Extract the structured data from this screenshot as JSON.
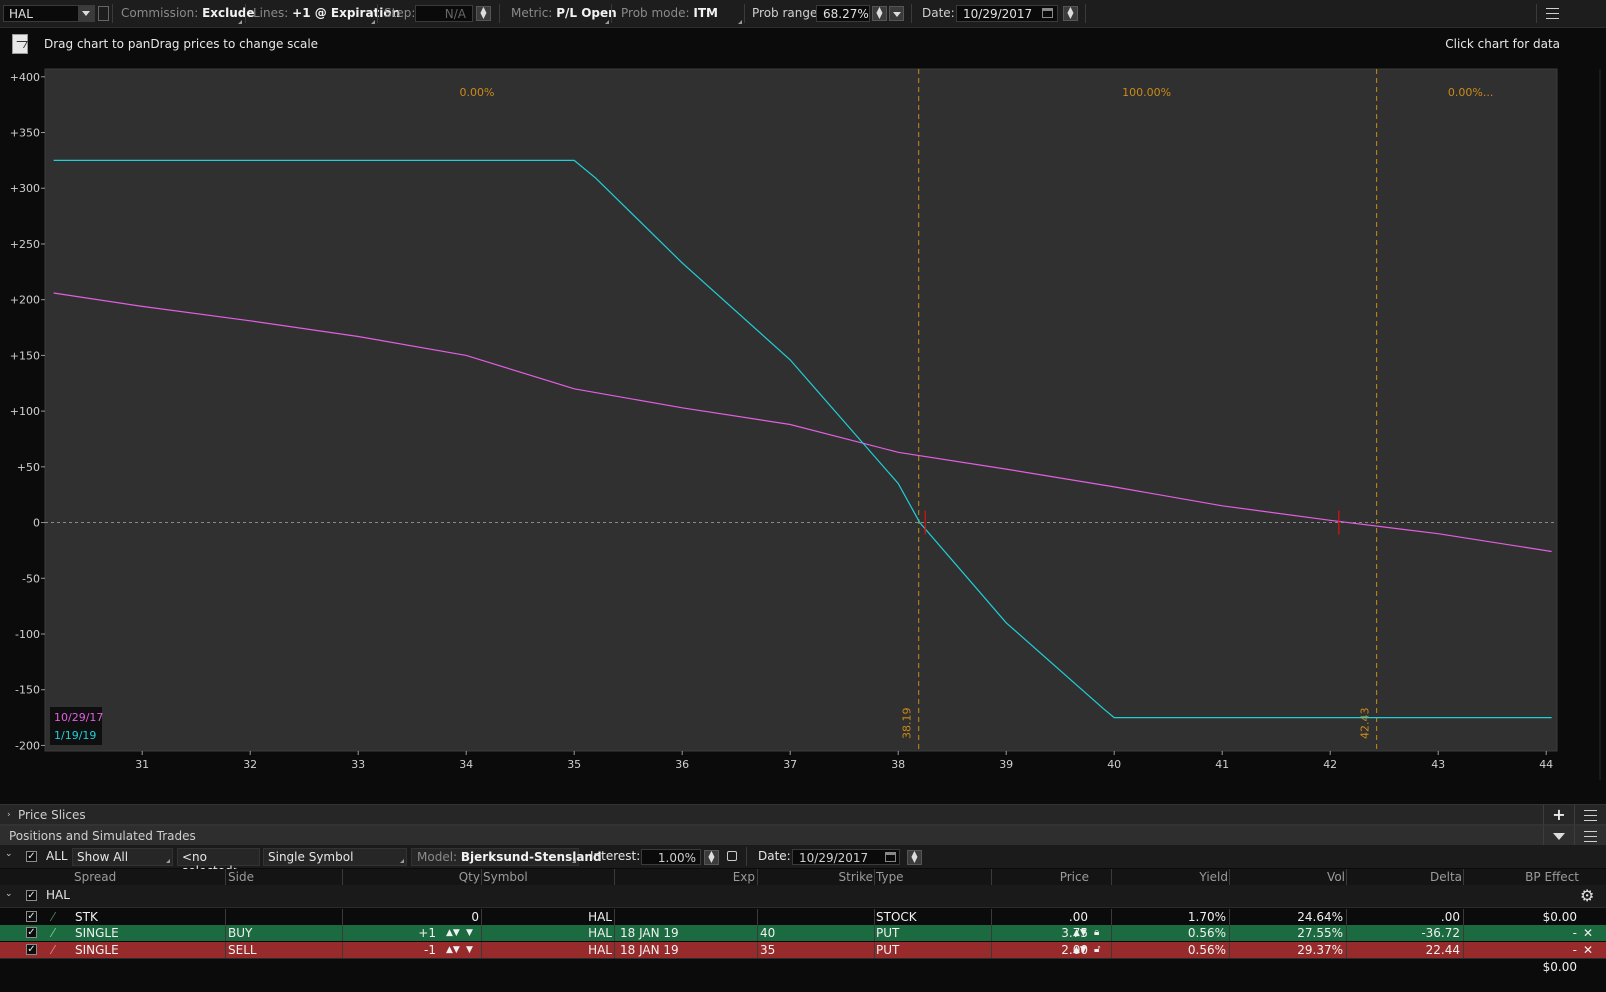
{
  "toolbar": {
    "symbol": "HAL",
    "commission_label": "Commission:",
    "commission_value": "Exclude",
    "lines_label": "Lines:",
    "lines_value": "+1 @ Expiration",
    "step_label": "Step:",
    "step_value": "N/A",
    "metric_label": "Metric:",
    "metric_value": "P/L Open",
    "prob_mode_label": "Prob mode:",
    "prob_mode_value": "ITM",
    "prob_range_label": "Prob range:",
    "prob_range_value": "68.27%",
    "date_label": "Date:",
    "date_value": "10/29/2017"
  },
  "chart_header": {
    "hint": "Drag chart to panDrag prices to change scale",
    "data_hint": "Click chart for data"
  },
  "chart_data": {
    "type": "line",
    "x_ticks": [
      "31",
      "32",
      "33",
      "34",
      "35",
      "36",
      "37",
      "38",
      "39",
      "40",
      "41",
      "42",
      "43",
      "44"
    ],
    "y_ticks": [
      "+400",
      "+350",
      "+300",
      "+250",
      "+200",
      "+150",
      "+100",
      "+50",
      "0",
      "-50",
      "-100",
      "-150",
      "-200"
    ],
    "xlim": [
      30.1,
      44.1
    ],
    "ylim": [
      -205,
      407
    ],
    "prob_labels": [
      {
        "text": "0.00%",
        "x": 34.1
      },
      {
        "text": "100.00%",
        "x": 40.3
      },
      {
        "text": "0.00%...",
        "x": 43.3
      }
    ],
    "markers": [
      {
        "x": 38.19,
        "label": "38.19"
      },
      {
        "x": 42.43,
        "label": "42.43"
      }
    ],
    "breakeven": [
      {
        "x": 38.25,
        "y": 0
      },
      {
        "x": 42.08,
        "y": 0
      }
    ],
    "series": [
      {
        "name": "10/29/17",
        "color": "#e15fe1",
        "points": [
          [
            30.18,
            206
          ],
          [
            31,
            194
          ],
          [
            32,
            181
          ],
          [
            33,
            167
          ],
          [
            34,
            150
          ],
          [
            35,
            120
          ],
          [
            36,
            103
          ],
          [
            37,
            88
          ],
          [
            38,
            63
          ],
          [
            39,
            48
          ],
          [
            40,
            32
          ],
          [
            41,
            15
          ],
          [
            42,
            2
          ],
          [
            43,
            -10
          ],
          [
            44.05,
            -26
          ]
        ]
      },
      {
        "name": "1/19/19",
        "color": "#20cfd8",
        "points": [
          [
            30.18,
            325
          ],
          [
            35,
            325
          ],
          [
            35.2,
            309
          ],
          [
            36,
            233
          ],
          [
            37,
            146
          ],
          [
            38,
            35
          ],
          [
            38.2,
            0
          ],
          [
            39,
            -90
          ],
          [
            39.9,
            -167
          ],
          [
            40,
            -175
          ],
          [
            41,
            -175
          ],
          [
            42,
            -175
          ],
          [
            43,
            -175
          ],
          [
            44.05,
            -175
          ]
        ]
      }
    ],
    "grid": false,
    "legend": "bottom-left"
  },
  "sections": {
    "price_slices": "Price Slices",
    "positions": "Positions and Simulated Trades"
  },
  "positions_toolbar": {
    "all_label": "ALL",
    "show_all": "Show All",
    "no_selected": "<no selected>",
    "single_symbol": "Single Symbol",
    "model_label": "Model:",
    "model_value": "Bjerksund-Stensland",
    "interest_label": "Interest:",
    "interest_value": "1.00%",
    "date_label": "Date:",
    "date_value": "10/29/2017"
  },
  "columns": {
    "spread": "Spread",
    "side": "Side",
    "qty": "Qty",
    "symbol": "Symbol",
    "exp": "Exp",
    "strike": "Strike",
    "type": "Type",
    "price": "Price",
    "yield": "Yield",
    "vol": "Vol",
    "delta": "Delta",
    "bp_effect": "BP Effect"
  },
  "group": {
    "name": "HAL"
  },
  "rows": [
    {
      "spread": "STK",
      "side": "",
      "qty": "0",
      "symbol": "HAL",
      "exp": "",
      "strike": "",
      "type": "STOCK",
      "price": ".00",
      "yield": "1.70%",
      "vol": "24.64%",
      "delta": ".00",
      "bp": "$0.00"
    },
    {
      "spread": "SINGLE",
      "side": "BUY",
      "qty": "+1",
      "symbol": "HAL",
      "exp": "18 JAN 19",
      "strike": "40",
      "type": "PUT",
      "price": "3.75",
      "yield": "0.56%",
      "vol": "27.55%",
      "delta": "-36.72",
      "bp": "-"
    },
    {
      "spread": "SINGLE",
      "side": "SELL",
      "qty": "-1",
      "symbol": "HAL",
      "exp": "18 JAN 19",
      "strike": "35",
      "type": "PUT",
      "price": "2.00",
      "yield": "0.56%",
      "vol": "29.37%",
      "delta": "22.44",
      "bp": "-"
    }
  ],
  "total": {
    "bp": "$0.00"
  }
}
